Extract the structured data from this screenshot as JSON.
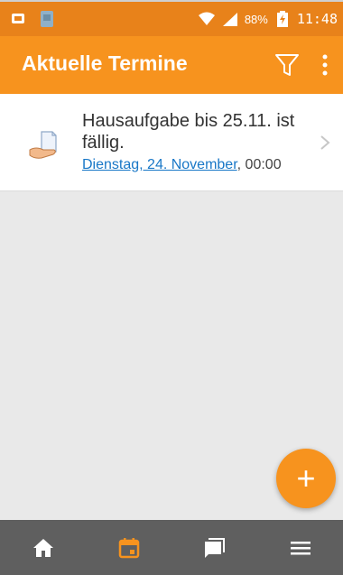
{
  "status_bar": {
    "battery_percent": "88%",
    "time": "11:48",
    "icons": [
      "notification-icon",
      "sim-icon",
      "wifi-icon",
      "signal-icon",
      "battery-charging-icon"
    ]
  },
  "app_bar": {
    "title": "Aktuelle Termine",
    "actions": [
      "filter-icon",
      "more-vertical-icon"
    ]
  },
  "events": [
    {
      "title": "Hausaufgabe bis 25.11. ist fällig.",
      "date_link": "Dienstag, 24. November",
      "time": ", 00:00",
      "icon": "assignment-icon"
    }
  ],
  "fab": {
    "label": "+"
  },
  "bottom_nav": {
    "tabs": [
      {
        "icon": "home-icon",
        "active": false
      },
      {
        "icon": "calendar-icon",
        "active": true
      },
      {
        "icon": "messages-icon",
        "active": false
      },
      {
        "icon": "menu-icon",
        "active": false
      }
    ]
  },
  "colors": {
    "status_bar": "#e8821a",
    "app_bar": "#f7931e",
    "accent": "#f7931e",
    "link": "#1877c7",
    "bottom_nav": "#5f5f5f",
    "background": "#e9e9e9"
  }
}
